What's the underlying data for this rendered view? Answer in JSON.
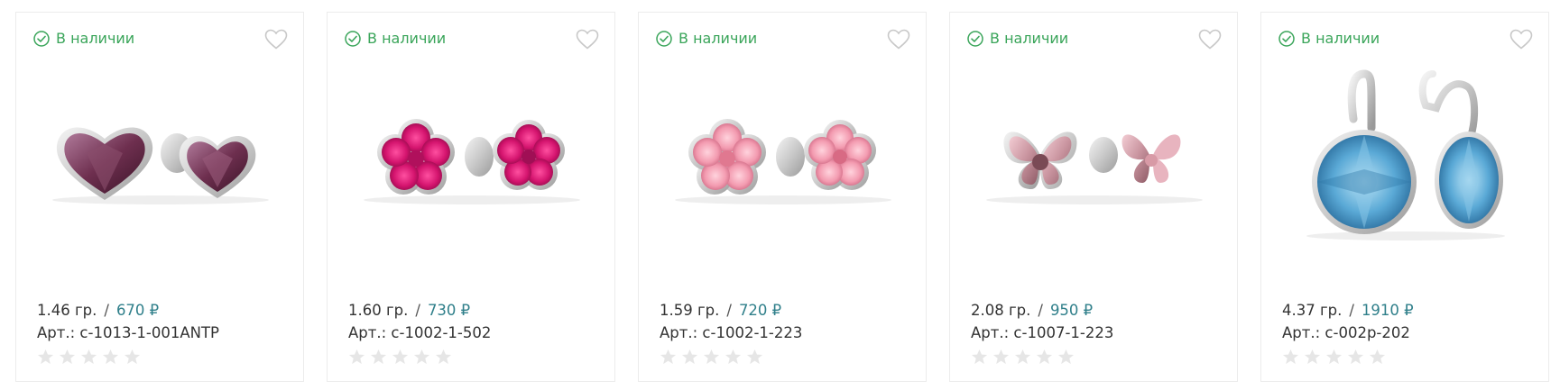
{
  "colors": {
    "stock": "#3aa55a",
    "price": "#2f7f8a",
    "star_empty": "#e6e6e6",
    "border": "#ececec"
  },
  "products": [
    {
      "stock_label": "В наличии",
      "weight": "1.46 гр.",
      "price": "670 ₽",
      "sku": "Арт.: с-1013-1-001ANTP",
      "rating": 0,
      "image": "heart-stud-earrings"
    },
    {
      "stock_label": "В наличии",
      "weight": "1.60 гр.",
      "price": "730 ₽",
      "sku": "Арт.: с-1002-1-502",
      "rating": 0,
      "image": "fuchsia-flower-stud-earrings"
    },
    {
      "stock_label": "В наличии",
      "weight": "1.59 гр.",
      "price": "720 ₽",
      "sku": "Арт.: с-1002-1-223",
      "rating": 0,
      "image": "pink-flower-stud-earrings"
    },
    {
      "stock_label": "В наличии",
      "weight": "2.08 гр.",
      "price": "950 ₽",
      "sku": "Арт.: с-1007-1-223",
      "rating": 0,
      "image": "butterfly-stud-earrings"
    },
    {
      "stock_label": "В наличии",
      "weight": "4.37 гр.",
      "price": "1910 ₽",
      "sku": "Арт.: с-002р-202",
      "rating": 0,
      "image": "blue-round-drop-earrings"
    }
  ]
}
